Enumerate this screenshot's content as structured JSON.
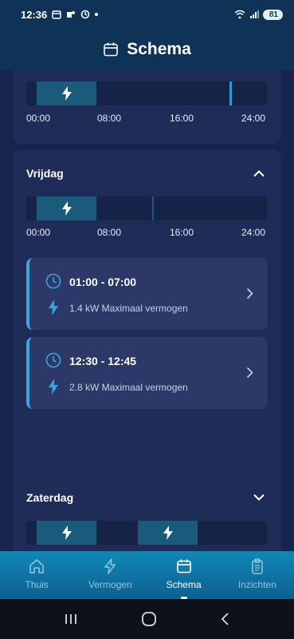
{
  "status": {
    "time": "12:36",
    "battery": "81"
  },
  "header": {
    "title": "Schema"
  },
  "timeline_labels": [
    "00:00",
    "08:00",
    "16:00",
    "24:00"
  ],
  "days": {
    "top_partial": {},
    "friday": {
      "name": "Vrijdag",
      "slots": [
        {
          "range": "01:00 - 07:00",
          "power": "1.4 kW Maximaal vermogen"
        },
        {
          "range": "12:30 - 12:45",
          "power": "2.8 kW Maximaal vermogen"
        }
      ]
    },
    "saturday": {
      "name": "Zaterdag"
    }
  },
  "nav": {
    "items": [
      {
        "label": "Thuis",
        "icon": "home-icon"
      },
      {
        "label": "Vermogen",
        "icon": "bolt-icon"
      },
      {
        "label": "Schema",
        "icon": "calendar-icon"
      },
      {
        "label": "Inzichten",
        "icon": "clipboard-icon"
      }
    ],
    "active": "Schema"
  },
  "colors": {
    "background": "#17244d",
    "card": "#1f2c58",
    "accent": "#2b9bd6",
    "danger": "#dd2b3d",
    "segment": "#1a5a7a"
  }
}
